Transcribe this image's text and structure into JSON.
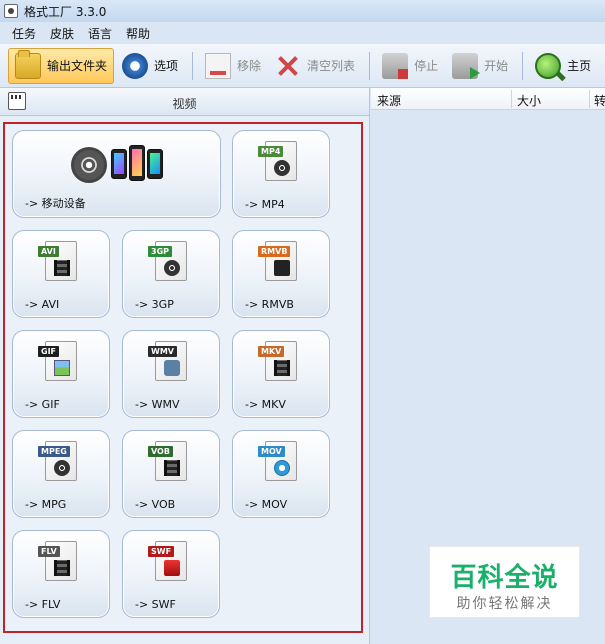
{
  "window": {
    "title": "格式工厂 3.3.0"
  },
  "menu": {
    "items": [
      "任务",
      "皮肤",
      "语言",
      "帮助"
    ]
  },
  "toolbar": {
    "output_folder": "输出文件夹",
    "options": "选项",
    "remove": "移除",
    "clear_list": "清空列表",
    "stop": "停止",
    "start": "开始",
    "home": "主页"
  },
  "left_panel": {
    "title": "视频",
    "tiles": [
      {
        "label": "-> 移动设备",
        "icon": "mobile-devices-icon"
      },
      {
        "label": "-> MP4",
        "badge": "MP4",
        "badge_color": "#4a8a3a",
        "icon": "mp4-file-icon"
      },
      {
        "label": "-> AVI",
        "badge": "AVI",
        "badge_color": "#3d7d2f",
        "icon": "avi-file-icon"
      },
      {
        "label": "-> 3GP",
        "badge": "3GP",
        "badge_color": "#2f8a3a",
        "icon": "3gp-file-icon"
      },
      {
        "label": "-> RMVB",
        "badge": "RMVB",
        "badge_color": "#d86a1e",
        "icon": "rmvb-file-icon"
      },
      {
        "label": "-> GIF",
        "badge": "GIF",
        "badge_color": "#1e1e1e",
        "icon": "gif-file-icon"
      },
      {
        "label": "-> WMV",
        "badge": "WMV",
        "badge_color": "#2a2a2a",
        "icon": "wmv-file-icon"
      },
      {
        "label": "-> MKV",
        "badge": "MKV",
        "badge_color": "#c56a2a",
        "icon": "mkv-file-icon"
      },
      {
        "label": "-> MPG",
        "badge": "MPEG",
        "badge_color": "#3a5a8a",
        "icon": "mpg-file-icon"
      },
      {
        "label": "-> VOB",
        "badge": "VOB",
        "badge_color": "#2f6a2f",
        "icon": "vob-file-icon"
      },
      {
        "label": "-> MOV",
        "badge": "MOV",
        "badge_color": "#2f8ac8",
        "icon": "mov-file-icon"
      },
      {
        "label": "-> FLV",
        "badge": "FLV",
        "badge_color": "#555555",
        "icon": "flv-file-icon"
      },
      {
        "label": "-> SWF",
        "badge": "SWF",
        "badge_color": "#b11a1a",
        "icon": "swf-file-icon"
      }
    ]
  },
  "task_list": {
    "columns": [
      "来源",
      "大小",
      "转"
    ]
  },
  "watermark": {
    "title": "百科全说",
    "subtitle": "助你轻松解决"
  },
  "colors": {
    "highlight_border": "#c0232c",
    "active_button": "#ffc95a",
    "watermark_green": "#19b06a"
  }
}
